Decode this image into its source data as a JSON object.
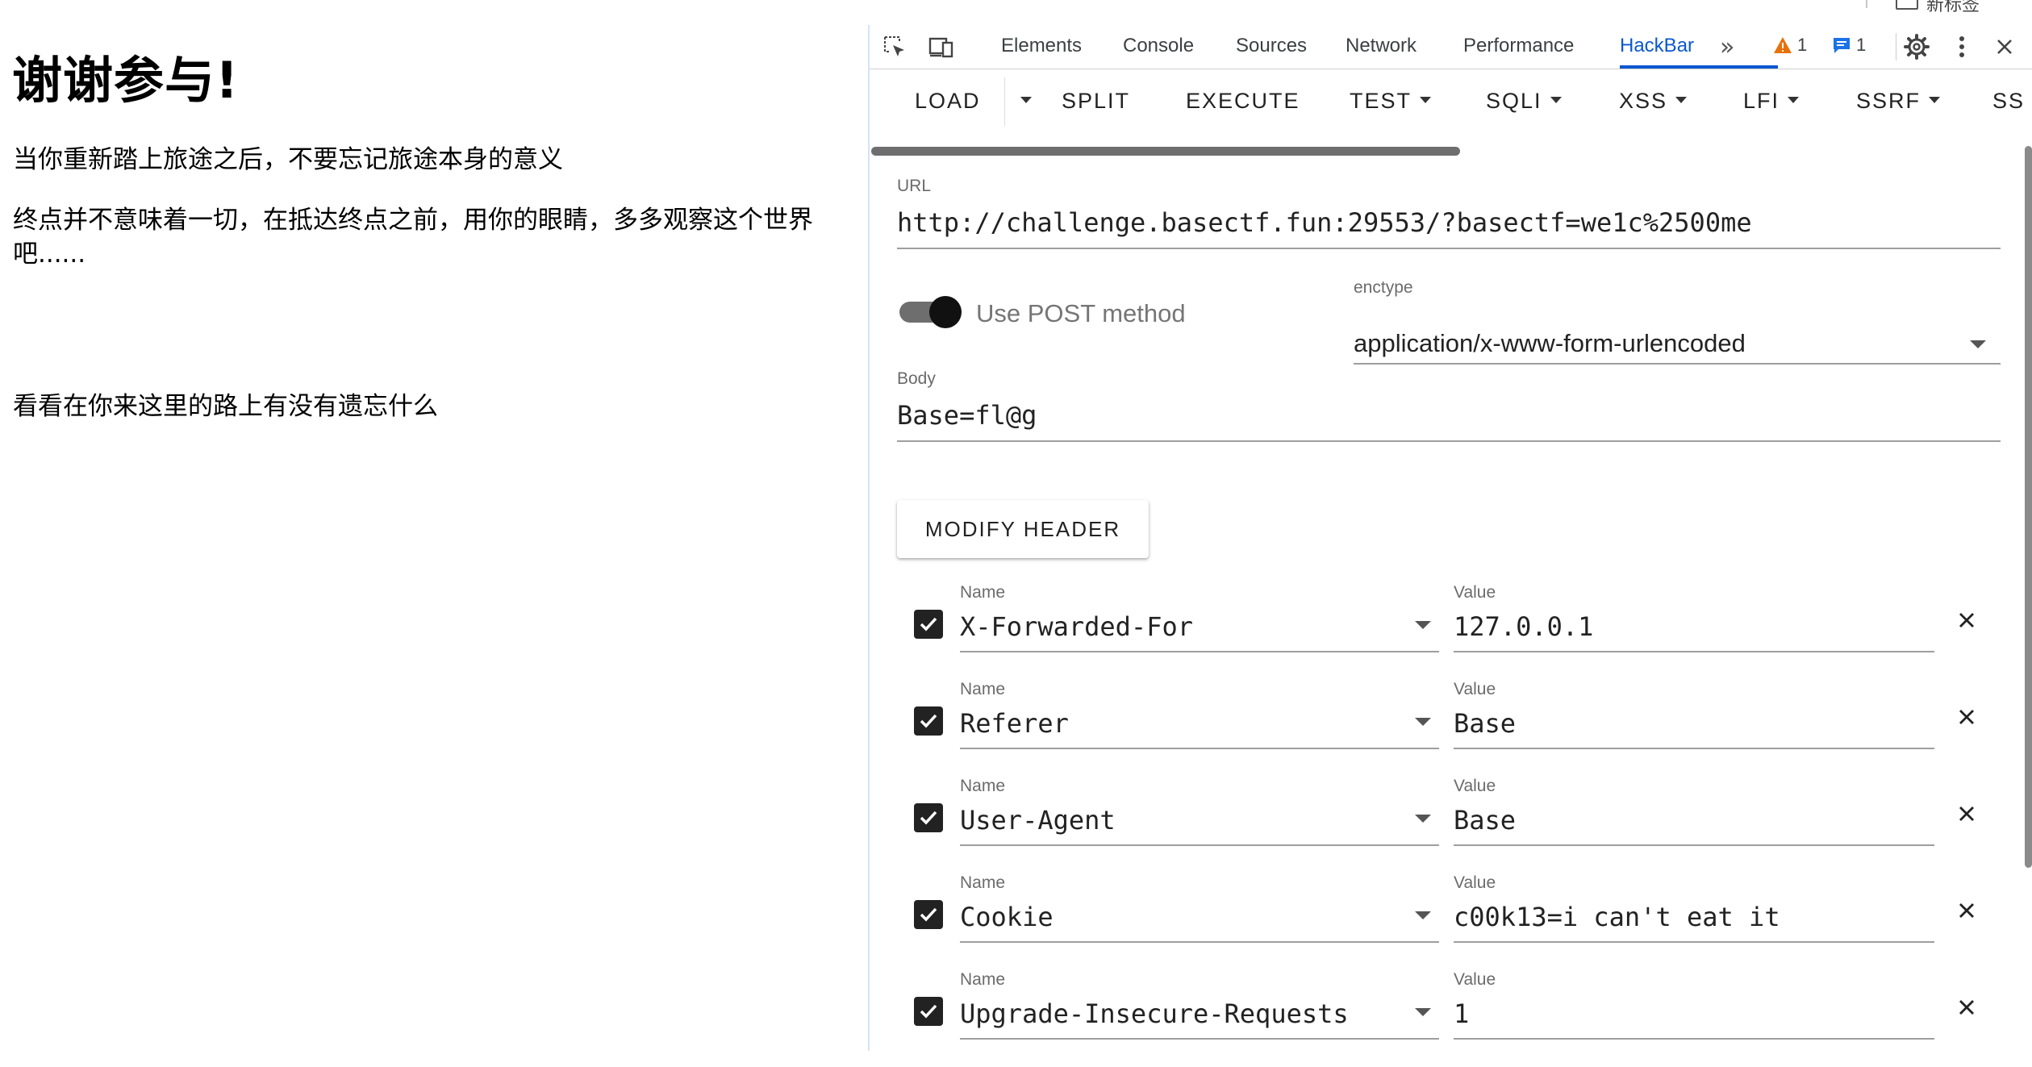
{
  "topbar": {
    "label": "新标签"
  },
  "page": {
    "heading": "谢谢参与!",
    "paragraphs": [
      "当你重新踏上旅途之后，不要忘记旅途本身的意义",
      "终点并不意味着一切，在抵达终点之前，用你的眼睛，多多观察这个世界吧......",
      "看看在你来这里的路上有没有遗忘什么"
    ]
  },
  "devtools": {
    "tabs": [
      "Elements",
      "Console",
      "Sources",
      "Network",
      "Performance",
      "HackBar"
    ],
    "active_tab": "HackBar",
    "more_tabs_glyph": "»",
    "warnings_count": "1",
    "messages_count": "1",
    "icons": [
      "inspect-icon",
      "device-toggle-icon",
      "more-tabs-icon",
      "warning-icon",
      "message-icon",
      "gear-icon",
      "kebab-menu-icon",
      "close-icon"
    ]
  },
  "hackbar": {
    "buttons": [
      "LOAD",
      "SPLIT",
      "EXECUTE",
      "TEST",
      "SQLI",
      "XSS",
      "LFI",
      "SSRF",
      "SS"
    ],
    "url": {
      "label": "URL",
      "value": "http://challenge.basectf.fun:29553/?basectf=we1c%2500me"
    },
    "post": {
      "label": "Use POST method",
      "enabled": true
    },
    "enctype": {
      "label": "enctype",
      "value": "application/x-www-form-urlencoded"
    },
    "body": {
      "label": "Body",
      "value": "Base=fl@g"
    },
    "modify_header_label": "MODIFY HEADER",
    "header_name_label": "Name",
    "header_value_label": "Value",
    "headers": [
      {
        "name": "X-Forwarded-For",
        "value": "127.0.0.1",
        "checked": true
      },
      {
        "name": "Referer",
        "value": "Base",
        "checked": true
      },
      {
        "name": "User-Agent",
        "value": "Base",
        "checked": true
      },
      {
        "name": "Cookie",
        "value": "c00k13=i can't eat it",
        "checked": true
      },
      {
        "name": "Upgrade-Insecure-Requests",
        "value": "1",
        "checked": true
      }
    ]
  },
  "colors": {
    "accent": "#0b57d0",
    "warning": "#e8710a",
    "message": "#1a73e8"
  }
}
